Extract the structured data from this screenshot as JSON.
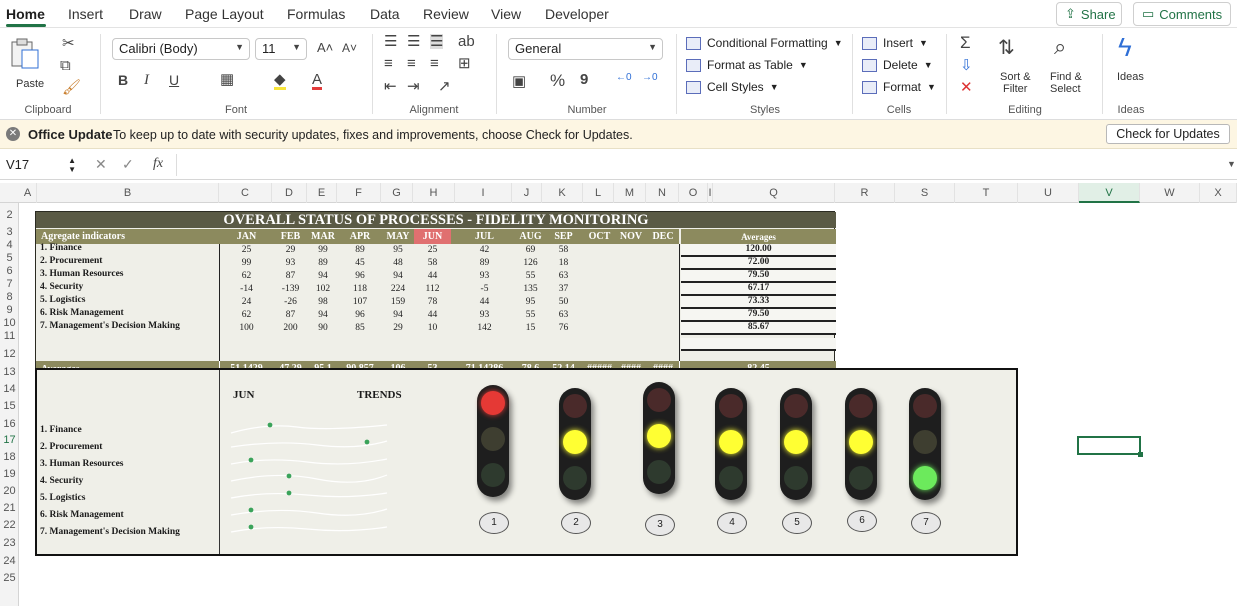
{
  "tabs": [
    "Home",
    "Insert",
    "Draw",
    "Page Layout",
    "Formulas",
    "Data",
    "Review",
    "View",
    "Developer"
  ],
  "top_buttons": {
    "share": "Share",
    "comments": "Comments"
  },
  "ribbon": {
    "clipboard": {
      "paste": "Paste",
      "label": "Clipboard"
    },
    "font": {
      "name": "Calibri (Body)",
      "size": "11",
      "label": "Font",
      "bold": "B",
      "italic": "I",
      "underline": "U"
    },
    "alignment": {
      "label": "Alignment"
    },
    "number": {
      "format": "General",
      "label": "Number",
      "percent": "%",
      "comma": "9"
    },
    "styles": {
      "conditional": "Conditional Formatting",
      "table": "Format as Table",
      "cell_styles": "Cell Styles",
      "label": "Styles"
    },
    "cells": {
      "insert": "Insert",
      "delete": "Delete",
      "format": "Format",
      "label": "Cells"
    },
    "editing": {
      "sort": "Sort &",
      "filter": "Filter",
      "find": "Find &",
      "select": "Select",
      "label": "Editing"
    },
    "ideas": {
      "button": "Ideas",
      "label": "Ideas"
    }
  },
  "infobar": {
    "title": "Office Update",
    "message": "To keep up to date with security updates, fixes and improvements, choose Check for Updates.",
    "button": "Check for Updates"
  },
  "formula": {
    "namebox": "V17",
    "fx": "fx",
    "value": ""
  },
  "columns": [
    "A",
    "B",
    "C",
    "D",
    "E",
    "F",
    "G",
    "H",
    "I",
    "J",
    "K",
    "L",
    "M",
    "N",
    "O",
    "I",
    "Q",
    "R",
    "S",
    "T",
    "U",
    "V",
    "W",
    "X"
  ],
  "rows": [
    "2",
    "3",
    "4",
    "5",
    "6",
    "7",
    "8",
    "9",
    "10",
    "11",
    "12",
    "13",
    "14",
    "15",
    "16",
    "17",
    "18",
    "19",
    "20",
    "21",
    "22",
    "23",
    "24",
    "25"
  ],
  "dashboard": {
    "title": "OVERALL STATUS OF PROCESSES - FIDELITY MONITORING",
    "agg_label": "Agregate indicators",
    "months": [
      "JAN",
      "FEB",
      "MAR",
      "APR",
      "MAY",
      "JUN",
      "JUL",
      "AUG",
      "SEP",
      "OCT",
      "NOV",
      "DEC"
    ],
    "averages_label": "Averages",
    "indicators": [
      "1. Finance",
      "2. Procurement",
      "3. Human Resources",
      "4. Security",
      "5. Logistics",
      "6. Risk Management",
      "7. Management's Decision Making"
    ],
    "values": [
      [
        "25",
        "29",
        "99",
        "89",
        "95",
        "25",
        "42",
        "69",
        "58"
      ],
      [
        "99",
        "93",
        "89",
        "45",
        "48",
        "58",
        "89",
        "126",
        "18"
      ],
      [
        "62",
        "87",
        "94",
        "96",
        "94",
        "44",
        "93",
        "55",
        "63"
      ],
      [
        "-14",
        "-139",
        "102",
        "118",
        "224",
        "112",
        "-5",
        "135",
        "37"
      ],
      [
        "24",
        "-26",
        "98",
        "107",
        "159",
        "78",
        "44",
        "95",
        "50"
      ],
      [
        "62",
        "87",
        "94",
        "96",
        "94",
        "44",
        "93",
        "55",
        "63"
      ],
      [
        "100",
        "200",
        "90",
        "85",
        "29",
        "10",
        "142",
        "15",
        "76"
      ]
    ],
    "row_averages": [
      "120.00",
      "72.00",
      "79.50",
      "67.17",
      "73.33",
      "79.50",
      "85.67"
    ],
    "averages_row_label": "Averages",
    "averages_row": [
      "51.1429",
      "47.29",
      "95.1",
      "90.857",
      "106",
      "53",
      "71.14286",
      "78.6",
      "52.14",
      "#####",
      "####",
      "####"
    ],
    "overall_average": "82.45"
  },
  "lower": {
    "month": "JUN",
    "trends": "TRENDS",
    "lights": [
      {
        "num": "1",
        "state": "red"
      },
      {
        "num": "2",
        "state": "yellow"
      },
      {
        "num": "3",
        "state": "yellow"
      },
      {
        "num": "4",
        "state": "yellow"
      },
      {
        "num": "5",
        "state": "yellow"
      },
      {
        "num": "6",
        "state": "yellow"
      },
      {
        "num": "7",
        "state": "green"
      }
    ]
  },
  "colors": {
    "accent": "#217346",
    "red": "#e53935",
    "yellow": "#ffff33",
    "green": "#6cea5c",
    "olive": "#8c8a5e"
  }
}
